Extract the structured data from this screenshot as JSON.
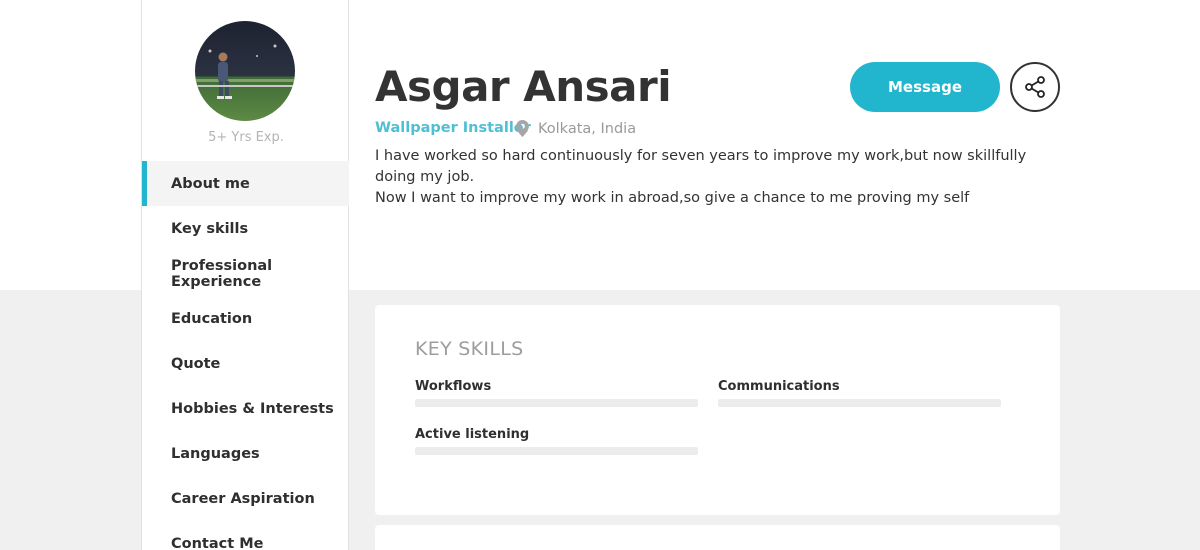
{
  "profile": {
    "name": "Asgar Ansari",
    "role": "Wallpaper Installer",
    "location": "Kolkata, India",
    "bio_line1": "I have worked so hard continuously for seven years to improve my work,but now skillfully doing my job.",
    "bio_line2": "Now I want to improve my work in abroad,so give a chance to me proving my self",
    "experience": "5+ Yrs Exp."
  },
  "actions": {
    "message_label": "Message",
    "share_icon": "share-icon"
  },
  "sidebar": {
    "items": [
      {
        "label": "About me",
        "active": true
      },
      {
        "label": "Key skills",
        "active": false
      },
      {
        "label": "Professional Experience",
        "active": false
      },
      {
        "label": "Education",
        "active": false
      },
      {
        "label": "Quote",
        "active": false
      },
      {
        "label": "Hobbies & Interests",
        "active": false
      },
      {
        "label": "Languages",
        "active": false
      },
      {
        "label": "Career Aspiration",
        "active": false
      },
      {
        "label": "Contact Me",
        "active": false
      }
    ]
  },
  "key_skills": {
    "title": "KEY SKILLS",
    "skills": [
      {
        "label": "Workflows",
        "level": 0
      },
      {
        "label": "Communications",
        "level": 0
      },
      {
        "label": "Active listening",
        "level": 0
      }
    ]
  },
  "colors": {
    "accent": "#22b6ce",
    "role_text": "#4fbfd3",
    "page_bg": "#f0f0f0"
  }
}
